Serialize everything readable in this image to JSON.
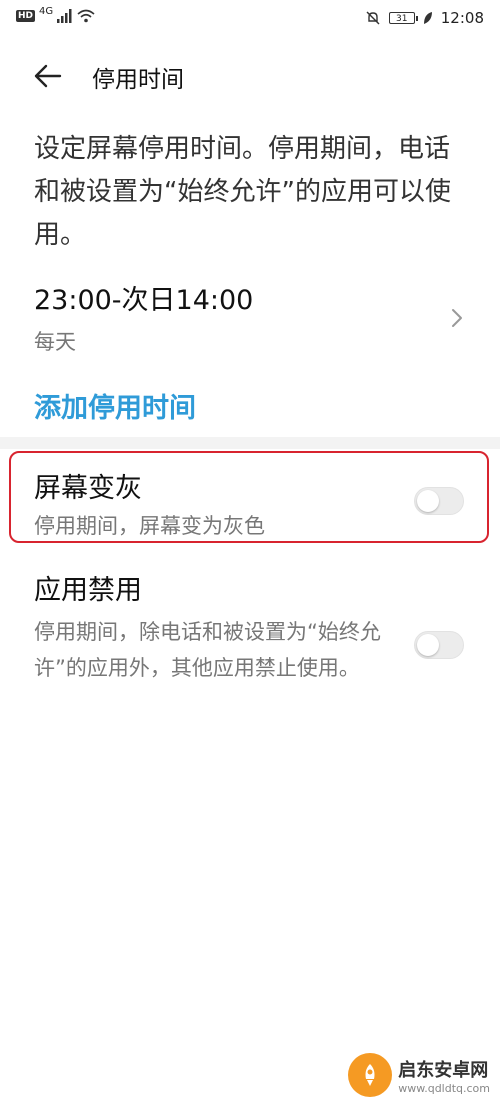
{
  "status_bar": {
    "network": "HD",
    "signal_label": "4G",
    "battery": "31",
    "time": "12:08"
  },
  "header": {
    "title": "停用时间"
  },
  "description": "设定屏幕停用时间。停用期间，电话和被设置为“始终允许”的应用可以使用。",
  "schedule": {
    "time": "23:00-次日14:00",
    "repeat": "每天"
  },
  "add_label": "添加停用时间",
  "settings": [
    {
      "title": "屏幕变灰",
      "subtitle": "停用期间，屏幕变为灰色",
      "enabled": false
    },
    {
      "title": "应用禁用",
      "subtitle": "停用期间，除电话和被设置为“始终允许”的应用外，其他应用禁止使用。",
      "enabled": false
    }
  ],
  "watermark": {
    "name": "启东安卓网",
    "url": "www.qdldtq.com"
  },
  "colors": {
    "accent": "#2f9bd8",
    "highlight_border": "#d8242f"
  }
}
